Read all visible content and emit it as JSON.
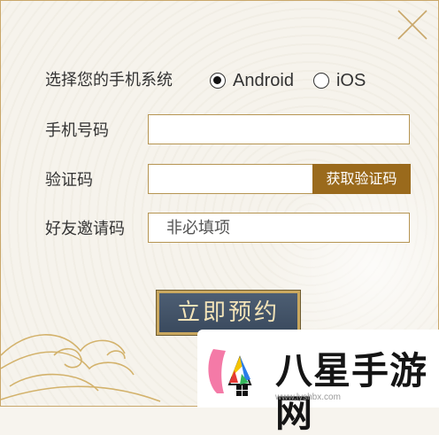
{
  "close_icon": "close-icon",
  "os_row": {
    "label": "选择您的手机系统",
    "options": [
      {
        "label": "Android",
        "checked": true
      },
      {
        "label": "iOS",
        "checked": false
      }
    ]
  },
  "phone_row": {
    "label": "手机号码",
    "value": "",
    "placeholder": ""
  },
  "code_row": {
    "label": "验证码",
    "value": "",
    "button": "获取验证码"
  },
  "invite_row": {
    "label": "好友邀请码",
    "placeholder": "非必填项"
  },
  "submit_label": "立即预约",
  "watermark": {
    "title": "八星手游网",
    "sub": "www.lyshbx.com"
  },
  "colors": {
    "accent": "#9a6a1c",
    "border": "#b69552",
    "button_bg": "#45566b",
    "button_text": "#f2e3b8"
  }
}
